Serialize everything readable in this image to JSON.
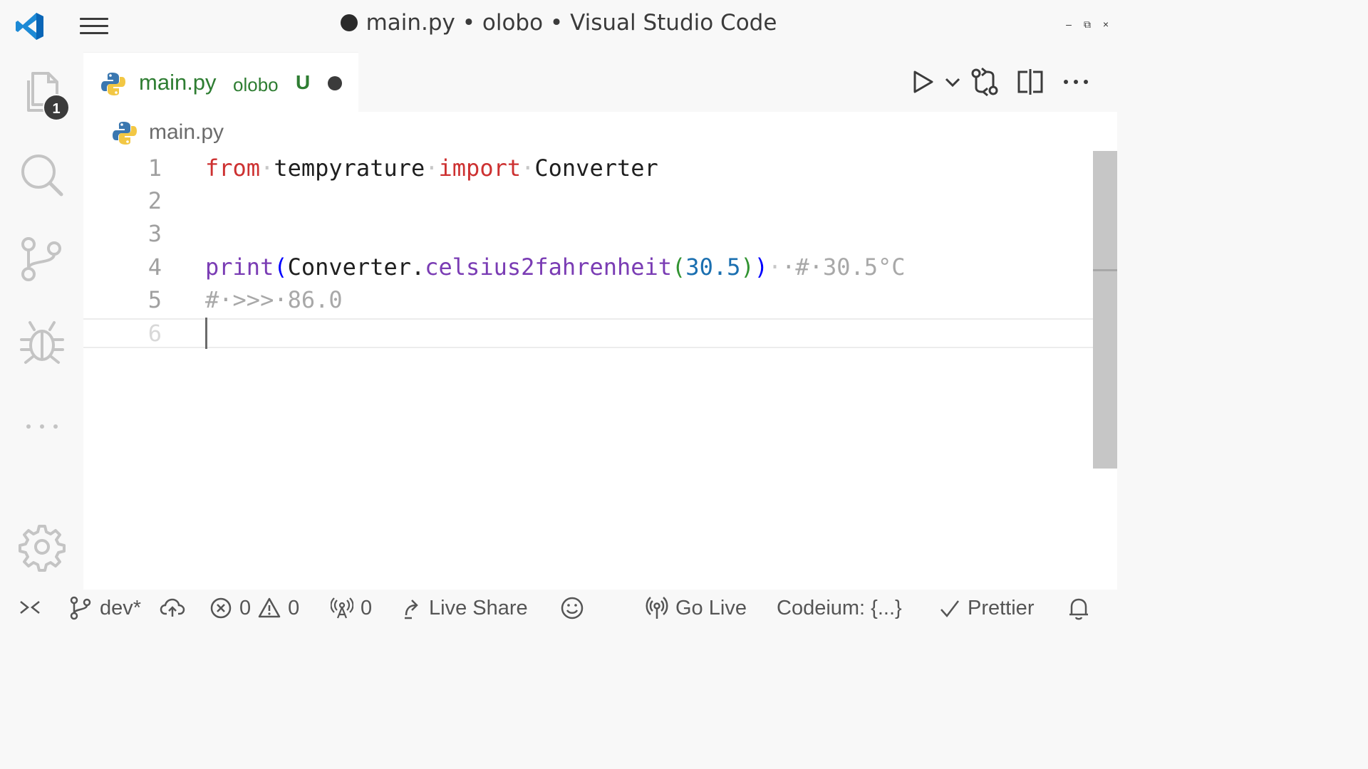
{
  "window": {
    "title": "main.py • olobo • Visual Studio Code",
    "controls": {
      "minimize": "–",
      "maximize": "⧉",
      "close": "×"
    }
  },
  "activity_bar": {
    "explorer_badge": "1",
    "items": [
      "explorer-icon",
      "search-icon",
      "source-control-icon",
      "debug-icon",
      "more-icon",
      "settings-gear-icon"
    ]
  },
  "tab": {
    "label": "main.py",
    "description": "olobo",
    "status": "U",
    "icon": "python-icon",
    "dirty": true
  },
  "editor_actions": [
    "run-icon",
    "chevron-down-icon",
    "compare-changes-icon",
    "split-editor-icon",
    "more-actions-icon"
  ],
  "breadcrumb": {
    "file": "main.py"
  },
  "code": {
    "line_numbers": [
      "1",
      "2",
      "3",
      "4",
      "5",
      "6"
    ],
    "l1": {
      "from": "from",
      "module": "tempyrature",
      "import": "import",
      "name": "Converter",
      "dot": "·"
    },
    "l4": {
      "print": "print",
      "open1": "(",
      "obj": "Converter",
      "dot": ".",
      "method": "celsius2fahrenheit",
      "open2": "(",
      "num": "30.5",
      "close2": ")",
      "close1": ")",
      "comment": "·#·30.5°C"
    },
    "l5": {
      "comment": "#·>>>·86.0"
    }
  },
  "colors": {
    "keyword": "#cd3131",
    "function": "#7a3cb4",
    "number": "#1a6fb0",
    "comment": "#a8a8a8",
    "tab_text": "#2e7d32",
    "accent_blue": "#0078d4"
  },
  "status_bar": {
    "branch": "dev*",
    "errors": "0",
    "warnings": "0",
    "ports": "0",
    "live_share": "Live Share",
    "go_live": "Go Live",
    "codeium": "Codeium: {...}",
    "prettier": "Prettier"
  }
}
